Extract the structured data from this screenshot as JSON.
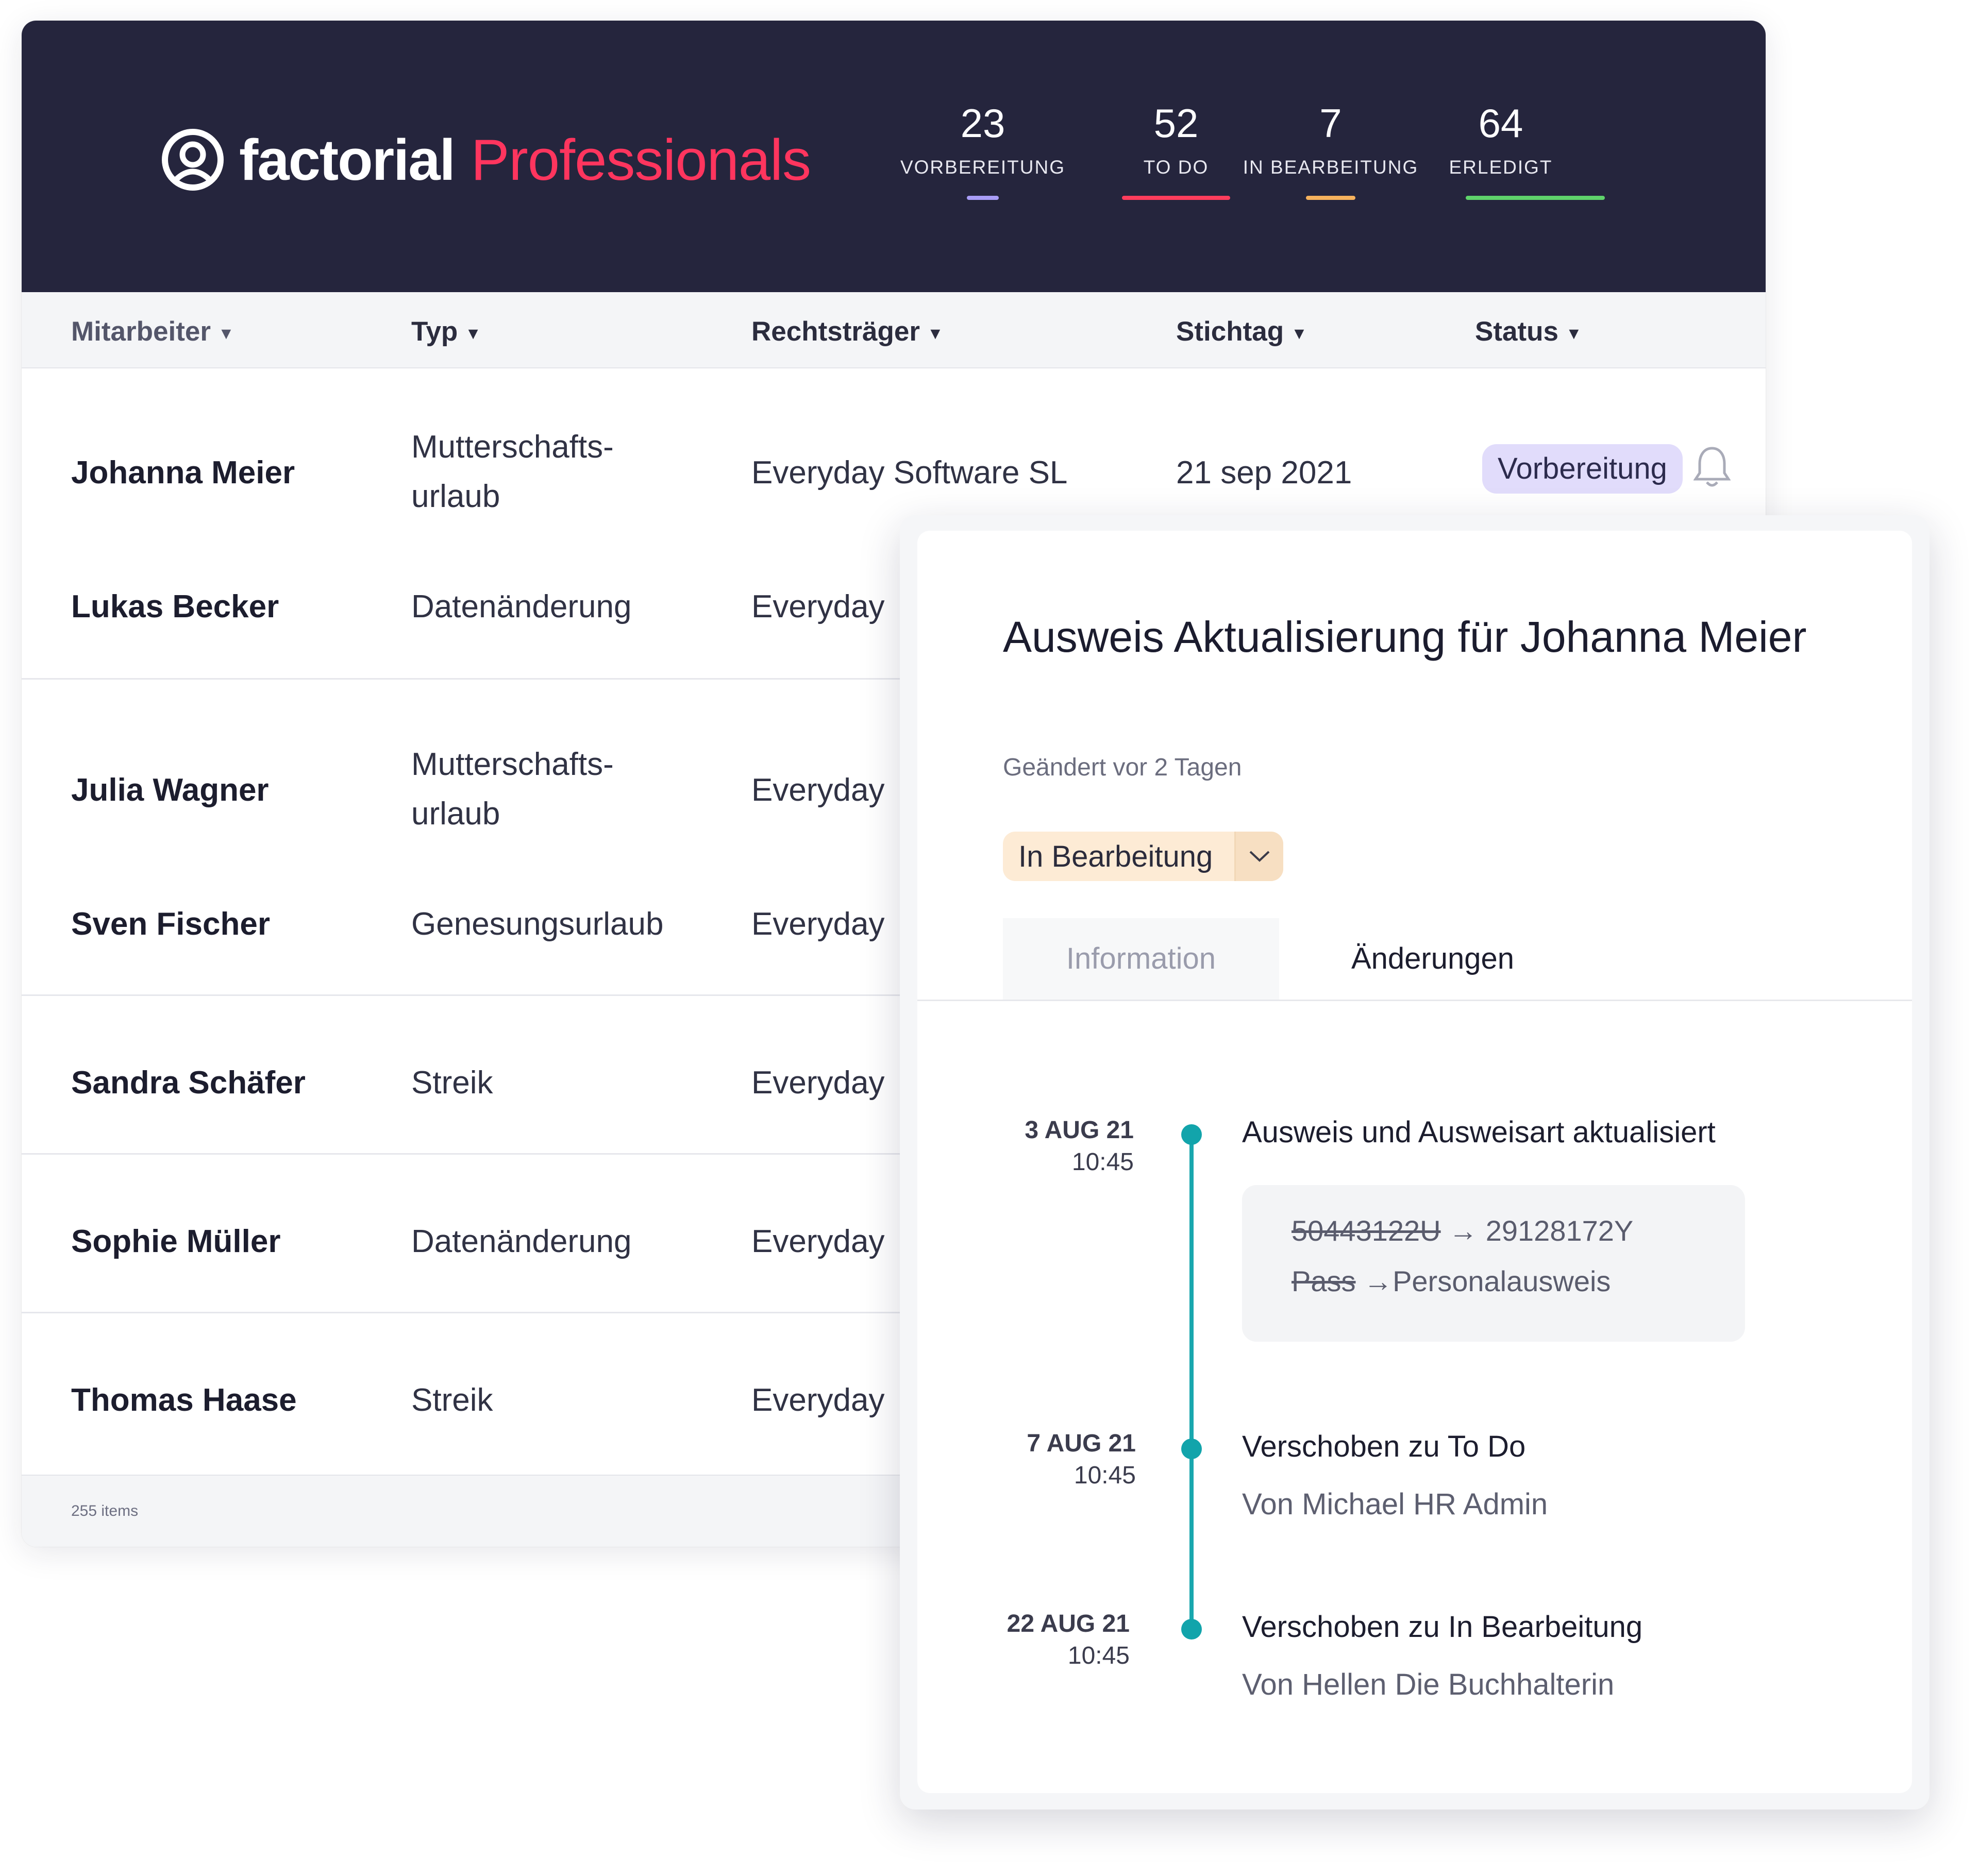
{
  "brand": {
    "name": "factorial",
    "product": "Professionals"
  },
  "stats": [
    {
      "value": "23",
      "label": "VORBEREITUNG",
      "color": "#a99df7"
    },
    {
      "value": "52",
      "label": "TO DO",
      "color": "#ff3d5c"
    },
    {
      "value": "7",
      "label": "IN BEARBEITUNG",
      "color": "#f6b25d"
    },
    {
      "value": "64",
      "label": "ERLEDIGT",
      "color": "#5fd36b"
    }
  ],
  "table": {
    "headers": [
      "Mitarbeiter",
      "Typ",
      "Rechtsträger",
      "Stichtag",
      "Status"
    ],
    "rows": [
      {
        "name": "Johanna Meier",
        "type_line1": "Mutterschafts-",
        "type_line2": "urlaub",
        "entity": "Everyday Software SL",
        "date": "21 sep 2021",
        "status": "Vorbereitung"
      },
      {
        "name": "Lukas Becker",
        "type": "Datenänderung",
        "entity": "Everyday "
      },
      {
        "name": "Julia Wagner",
        "type_line1": "Mutterschafts-",
        "type_line2": "urlaub",
        "entity": "Everyday "
      },
      {
        "name": "Sven Fischer",
        "type": "Genesungsurlaub",
        "entity": "Everyday "
      },
      {
        "name": "Sandra Schäfer",
        "type": "Streik",
        "entity": "Everyday "
      },
      {
        "name": "Sophie Müller",
        "type": "Datenänderung",
        "entity": "Everyday "
      },
      {
        "name": "Thomas Haase",
        "type": "Streik",
        "entity": "Everyday "
      }
    ],
    "footer": "255 items"
  },
  "panel": {
    "title": "Ausweis Aktualisierung für Johanna Meier",
    "modified": "Geändert vor 2 Tagen",
    "status": "In Bearbeitung",
    "tabs": [
      "Information",
      "Änderungen"
    ],
    "timeline": [
      {
        "date": "3 AUG 21",
        "time": "10:45",
        "title": "Ausweis und Ausweisart aktualisiert",
        "changes": [
          {
            "old": "50443122U",
            "arrow": " → ",
            "new": "29128172Y"
          },
          {
            "old": "Pass",
            "arrow": " →",
            "new": "Personalausweis"
          }
        ]
      },
      {
        "date": "7 AUG 21",
        "time": "10:45",
        "title": "Verschoben zu To Do",
        "by": "Von Michael HR Admin"
      },
      {
        "date": "22 AUG 21",
        "time": "10:45",
        "title": "Verschoben zu In Bearbeitung",
        "by": "Von Hellen Die Buchhalterin"
      }
    ]
  },
  "colors": {
    "header_bg": "#25253d",
    "accent": "#ff355e",
    "timeline": "#12a4ab"
  }
}
